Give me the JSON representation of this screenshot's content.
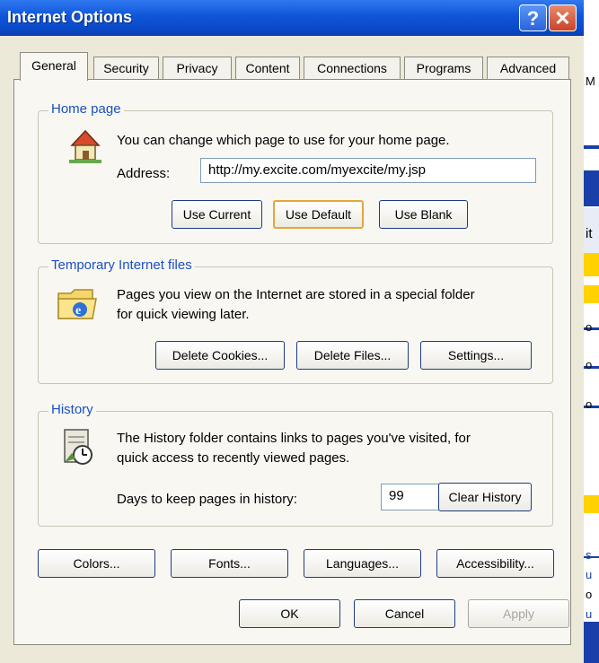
{
  "window": {
    "title": "Internet Options",
    "help_icon": "?",
    "close_icon": "✕"
  },
  "tabs": [
    {
      "label": "General",
      "active": true
    },
    {
      "label": "Security"
    },
    {
      "label": "Privacy"
    },
    {
      "label": "Content"
    },
    {
      "label": "Connections"
    },
    {
      "label": "Programs"
    },
    {
      "label": "Advanced"
    }
  ],
  "home_page": {
    "legend": "Home page",
    "description": "You can change which page to use for your home page.",
    "address_label": "Address:",
    "address_value": "http://my.excite.com/myexcite/my.jsp",
    "buttons": {
      "use_current": "Use Current",
      "use_default": "Use Default",
      "use_blank": "Use Blank"
    },
    "icon": "house-icon"
  },
  "temp_files": {
    "legend": "Temporary Internet files",
    "description_line1": "Pages you view on the Internet are stored in a special folder",
    "description_line2": "for quick viewing later.",
    "buttons": {
      "delete_cookies": "Delete Cookies...",
      "delete_files": "Delete Files...",
      "settings": "Settings..."
    },
    "icon": "ie-folder-icon"
  },
  "history": {
    "legend": "History",
    "description_line1": "The History folder contains links to pages you've visited, for",
    "description_line2": "quick access to recently viewed pages.",
    "days_label": "Days to keep pages in history:",
    "days_value": "99",
    "clear_button": "Clear History",
    "icon": "history-icon"
  },
  "bottom_buttons": {
    "colors": "Colors...",
    "fonts": "Fonts...",
    "languages": "Languages...",
    "accessibility": "Accessibility..."
  },
  "dialog_buttons": {
    "ok": "OK",
    "cancel": "Cancel",
    "apply": "Apply"
  },
  "background_strip": {
    "letters": [
      "M",
      "it",
      "o",
      "o",
      "o",
      "s",
      "u",
      "o",
      "u"
    ]
  }
}
